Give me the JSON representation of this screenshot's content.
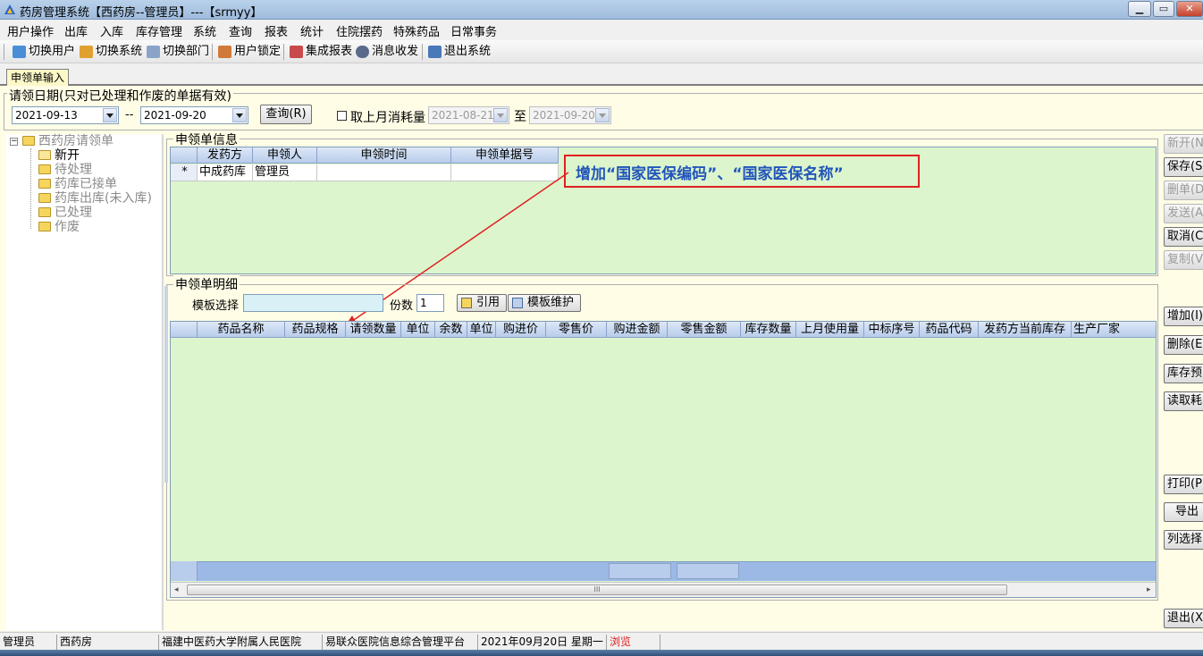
{
  "window": {
    "title": "药房管理系统【西药房--管理员】---【srmyy】",
    "min": "▁",
    "max": "▭",
    "close": "✕"
  },
  "menu": [
    "用户操作",
    "出库",
    "入库",
    "库存管理",
    "系统",
    "查询",
    "报表",
    "统计",
    "住院摆药",
    "特殊药品",
    "日常事务"
  ],
  "toolbar": [
    "切换用户",
    "切换系统",
    "切换部门",
    "用户锁定",
    "集成报表",
    "消息收发",
    "退出系统"
  ],
  "tab": "申领单输入",
  "date_group": {
    "title": "请领日期(只对已处理和作废的单据有效)",
    "from": "2021-09-13",
    "dash": "--",
    "to": "2021-09-20",
    "query_btn": "查询(R)",
    "checkbox_label": "取上月消耗量",
    "range_from": "2021-08-21",
    "to_label": "至",
    "range_to": "2021-09-20"
  },
  "tree": {
    "root": "西药房请领单",
    "items": [
      "新开",
      "待处理",
      "药库已接单",
      "药库出库(未入库)",
      "已处理",
      "作废"
    ]
  },
  "info": {
    "title": "申领单信息",
    "columns": [
      "发药方",
      "申领人",
      "申领时间",
      "申领单据号"
    ],
    "row": {
      "marker": "*",
      "cells": [
        "中成药库",
        "管理员",
        "",
        ""
      ]
    }
  },
  "annotation": "增加“国家医保编码”、“国家医保名称”",
  "detail": {
    "title": "申领单明细",
    "template_label": "模板选择",
    "copies_label": "份数",
    "copies_value": "1",
    "cite_btn": "引用",
    "tmpl_btn": "模板维护",
    "columns": [
      "药品名称",
      "药品规格",
      "请领数量",
      "单位",
      "余数",
      "单位",
      "购进价",
      "零售价",
      "购进金额",
      "零售金额",
      "库存数量",
      "上月使用量",
      "中标序号",
      "药品代码",
      "发药方当前库存",
      "生产厂家"
    ],
    "scroll_mark": "III"
  },
  "right_buttons": [
    "新开(N)",
    "保存(S)",
    "删单(D)",
    "发送(A)",
    "取消(C)",
    "复制(V)",
    "增加(I)",
    "删除(E)",
    "库存预",
    "读取耗",
    "打印(P)",
    "导出",
    "列选择",
    "退出(X)"
  ],
  "status": [
    "管理员",
    "西药房",
    "福建中医药大学附属人民医院",
    "易联众医院信息综合管理平台",
    "2021年09月20日 星期一",
    "浏览"
  ],
  "colors": {
    "grid_bg": "#dcf5cc",
    "panel_bg": "#fffde6",
    "annotation": "#e02020",
    "annotation_text": "#2255bb",
    "status_browse": "#e02020"
  }
}
